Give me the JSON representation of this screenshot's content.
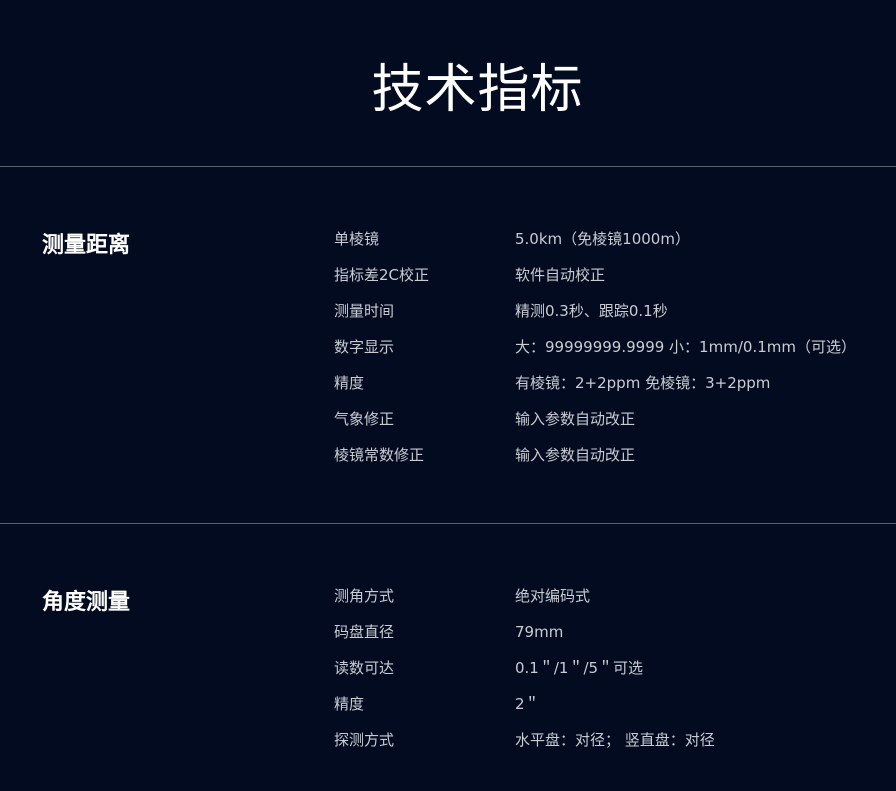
{
  "page": {
    "title": "技术指标"
  },
  "sections": [
    {
      "title": "测量距离",
      "rows": [
        {
          "label": "单棱镜",
          "value": "5.0km（免棱镜1000m）"
        },
        {
          "label": "指标差2C校正",
          "value": "软件自动校正"
        },
        {
          "label": "测量时间",
          "value": "精测0.3秒、跟踪0.1秒"
        },
        {
          "label": "数字显示",
          "value": "大：99999999.9999 小：1mm/0.1mm（可选）"
        },
        {
          "label": "精度",
          "value": "有棱镜：2+2ppm  免棱镜：3+2ppm"
        },
        {
          "label": "气象修正",
          "value": "输入参数自动改正"
        },
        {
          "label": "棱镜常数修正",
          "value": "输入参数自动改正"
        }
      ]
    },
    {
      "title": "角度测量",
      "rows": [
        {
          "label": "测角方式",
          "value": "绝对编码式"
        },
        {
          "label": "码盘直径",
          "value": "79mm"
        },
        {
          "label": "读数可达",
          "value": "0.1＂/1＂/5＂可选"
        },
        {
          "label": "精度",
          "value": "2＂"
        },
        {
          "label": "探测方式",
          "value": "水平盘：对径； 竖直盘：对径"
        }
      ]
    }
  ]
}
